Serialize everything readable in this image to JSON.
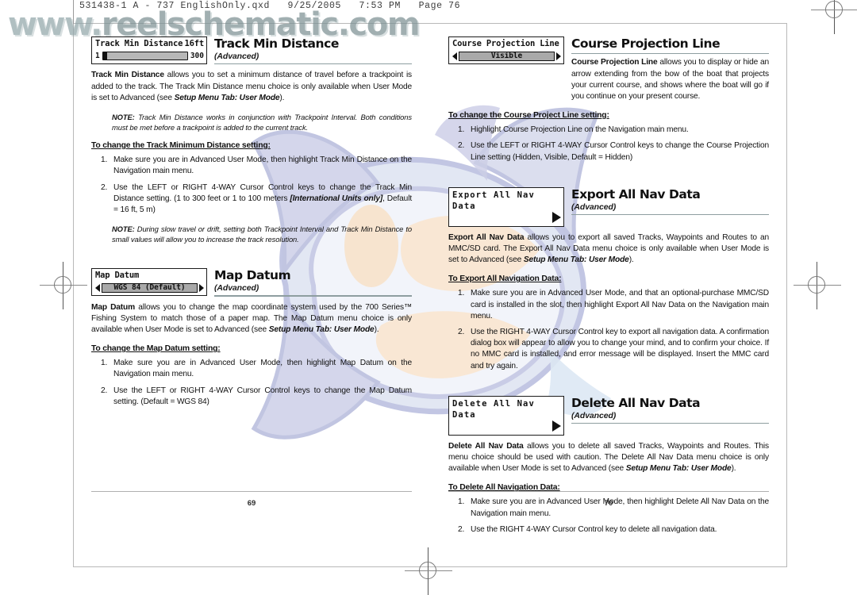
{
  "sheet": {
    "header_line": "531438-1 A - 737 EnglishOnly.qxd   9/25/2005   7:53 PM   Page 76",
    "watermark": "www.reelschematic.com",
    "watermark_prefix": "www.",
    "watermark_domain": "reelschematic.com"
  },
  "left_page": {
    "page_number": "69",
    "sections": [
      {
        "lcd": {
          "type": "slider",
          "label": "Track Min Distance",
          "value": "16ft",
          "min": "1",
          "max": "300"
        },
        "title": "Track Min Distance",
        "subtitle": "(Advanced)",
        "intro_bold": "Track Min Distance",
        "intro_text": " allows you to set a minimum distance of travel before a trackpoint is added to the track. The Track Min Distance menu choice is only available when User Mode is set to Advanced (see ",
        "intro_ref": "Setup Menu Tab: User Mode",
        "intro_tail": ").",
        "note1_label": "NOTE:",
        "note1_text": " Track Min Distance works in conjunction with Trackpoint Interval.  Both conditions must be met before a trackpoint is added to the current track.",
        "todo": "To change the Track Minimum Distance setting:",
        "steps": [
          "Make sure you are in Advanced User Mode, then highlight Track Min Distance on the Navigation main menu.",
          "Use the LEFT or RIGHT 4-WAY Cursor Control keys to change the Track Min Distance setting. (1 to 300 feet or 1 to 100 meters [International Units only], Default = 16 ft, 5 m)"
        ],
        "step2_pre": "Use the LEFT or RIGHT 4-WAY Cursor Control keys to change the Track Min Distance setting. (1 to 300 feet or 1 to 100 meters ",
        "step2_em": "[International Units only]",
        "step2_post": ", Default = 16 ft, 5 m)",
        "note2_label": "NOTE:",
        "note2_text": " During slow travel or drift, setting both Trackpoint Interval and Track Min Distance to small values will allow you to increase the track resolution."
      },
      {
        "lcd": {
          "type": "select",
          "label": "Map Datum",
          "value": "WGS 84 (Default)"
        },
        "title": "Map Datum",
        "subtitle": "(Advanced)",
        "intro_bold": "Map Datum",
        "intro_text": " allows you to change the map coordinate system used by the 700 Series™ Fishing System to match those of a paper map.  The Map Datum menu choice is only available when User Mode is set to Advanced (see ",
        "intro_ref": "Setup Menu Tab: User Mode",
        "intro_tail": ").",
        "todo": "To change the Map Datum setting:",
        "steps": [
          "Make sure you are in Advanced User Mode, then highlight Map Datum on the Navigation main menu.",
          "Use the LEFT or RIGHT 4-WAY Cursor Control keys to change the Map Datum setting. (Default = WGS 84)"
        ]
      }
    ]
  },
  "right_page": {
    "page_number": "70",
    "sections": [
      {
        "lcd": {
          "type": "select",
          "label": "Course Projection Line",
          "value": "Visible"
        },
        "title": "Course Projection Line",
        "subtitle": "",
        "intro_bold": "Course Projection Line",
        "intro_text": " allows you to display or hide an arrow extending from the bow of the boat that projects your current course, and shows where the boat will go if you continue on your present course.",
        "todo": "To change the Course Project Line setting:",
        "steps": [
          "Highlight Course Projection Line on the Navigation main menu.",
          "Use the LEFT or RIGHT 4-WAY Cursor Control keys to change the Course Projection Line setting (Hidden, Visible, Default = Hidden)"
        ]
      },
      {
        "lcd": {
          "type": "action",
          "label": "Export All Nav Data"
        },
        "title": "Export All Nav Data",
        "subtitle": "(Advanced)",
        "intro_bold": "Export All Nav Data",
        "intro_text": " allows you to export all saved Tracks, Waypoints and Routes to an MMC/SD card. The Export All Nav Data menu choice is only available when User Mode is set to Advanced (see ",
        "intro_ref": "Setup Menu Tab: User Mode",
        "intro_tail": ").",
        "todo": "To Export All Navigation Data:",
        "steps": [
          "Make sure you are in Advanced User Mode, and that an optional-purchase MMC/SD card is installed in the slot, then highlight Export All Nav Data on the Navigation main menu.",
          "Use the RIGHT 4-WAY Cursor Control key to export all navigation data.  A confirmation dialog box will appear to allow you to change your mind, and to confirm your choice. If no MMC card is installed, and error message will be displayed. Insert the MMC card and try again."
        ]
      },
      {
        "lcd": {
          "type": "action",
          "label": "Delete All Nav Data"
        },
        "title": "Delete All Nav Data",
        "subtitle": "(Advanced)",
        "intro_bold": "Delete All Nav Data",
        "intro_text": " allows you to delete all saved Tracks, Waypoints and Routes.  This menu choice should be used with caution. The Delete All Nav Data menu choice is only available when User Mode is set to Advanced (see ",
        "intro_ref": "Setup Menu Tab: User Mode",
        "intro_tail": ").",
        "todo": "To Delete All Navigation Data:",
        "steps": [
          "Make sure you are in Advanced User Mode, then highlight Delete All Nav Data on the Navigation main menu.",
          "Use the RIGHT 4-WAY Cursor Control key to delete all navigation data."
        ]
      }
    ]
  },
  "colors": {
    "watermark": "#7d9194",
    "rule": "#8e9ea0",
    "fish_purple": "#b9bcdd",
    "fish_peach": "#f7d9ba",
    "fish_blue": "#cfe0ef"
  }
}
